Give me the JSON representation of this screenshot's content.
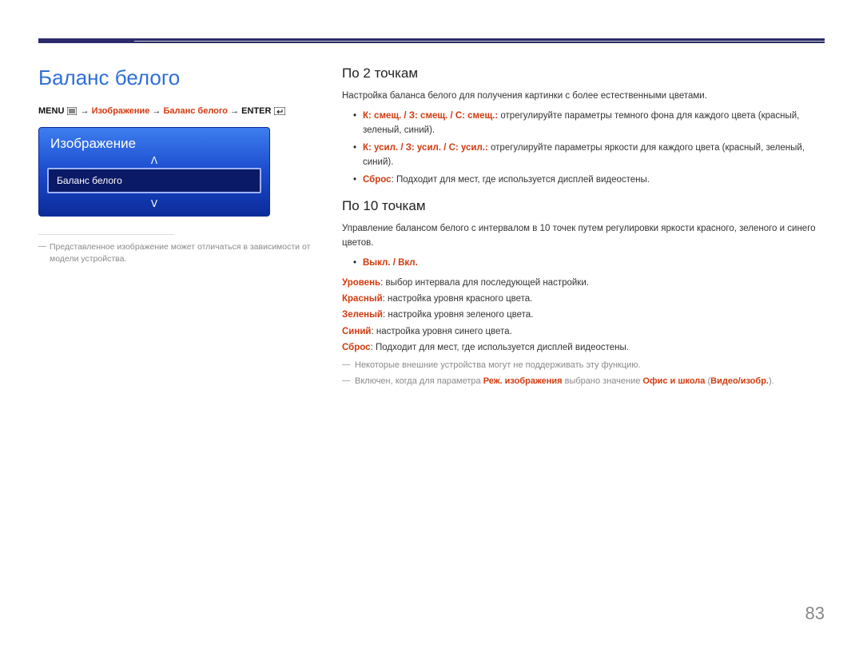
{
  "title": "Баланс белого",
  "breadcrumb": {
    "menu": "MENU",
    "arrow": "→",
    "item1": "Изображение",
    "item2": "Баланс белого",
    "enter": "ENTER"
  },
  "osd": {
    "panel_title": "Изображение",
    "chev_up": "ᐱ",
    "chev_down": "ᐯ",
    "selected_item": "Баланс белого"
  },
  "left_footnote": "Представленное изображение может отличаться в зависимости от модели устройства.",
  "sec2": {
    "heading": "По 2 точкам",
    "intro": "Настройка баланса белого для получения картинки с более естественными цветами.",
    "items": {
      "offset_keys": "К: смещ. / З: смещ. / С: смещ.:",
      "offset_text": " отрегулируйте параметры темного фона для каждого цвета (красный, зеленый, синий).",
      "gain_keys": "К: усил. / З: усил. / С: усил.:",
      "gain_text": " отрегулируйте параметры яркости для каждого цвета (красный, зеленый, синий).",
      "reset_key": "Сброс",
      "reset_text": ": Подходит для мест, где используется дисплей видеостены."
    }
  },
  "sec10": {
    "heading": "По 10 точкам",
    "intro": "Управление балансом белого с интервалом в 10 точек путем регулировки яркости красного, зеленого и синего цветов.",
    "onoff": "Выкл. / Вкл.",
    "defs": {
      "level_key": "Уровень",
      "level_text": ": выбор интервала для последующей настройки.",
      "red_key": "Красный",
      "red_text": ": настройка уровня красного цвета.",
      "green_key": "Зеленый",
      "green_text": ": настройка уровня зеленого цвета.",
      "blue_key": "Синий",
      "blue_text": ": настройка уровня синего цвета.",
      "reset_key": "Сброс",
      "reset_text": ": Подходит для мест, где используется дисплей видеостены."
    },
    "note1": "Некоторые внешние устройства могут не поддерживать эту функцию.",
    "note2": {
      "pre": "Включен, когда для параметра ",
      "key1": "Реж. изображения",
      "mid": " выбрано значение ",
      "key2": "Офис и школа",
      "open": " (",
      "key3": "Видео/изобр.",
      "close": ")."
    }
  },
  "page_number": "83"
}
